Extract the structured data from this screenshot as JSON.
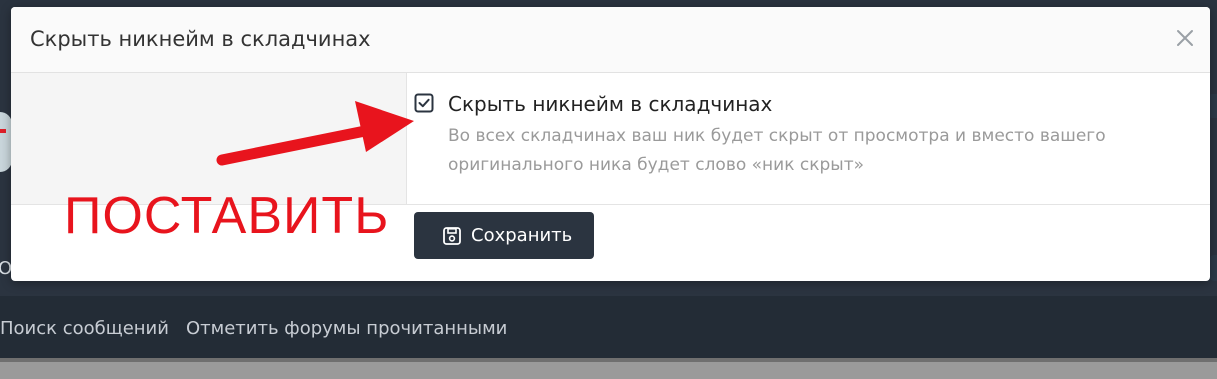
{
  "modal": {
    "title": "Скрыть никнейм в складчинах",
    "close_icon": "close-icon",
    "option": {
      "checked": true,
      "label": "Скрыть никнейм в складчинах",
      "hint_line1": "Во всех складчинах ваш ник будет скрыт от просмотра и вместо вашего",
      "hint_line2": "оригинального ника будет слово «ник скрыт»"
    },
    "save_button": {
      "label": "Сохранить",
      "icon": "save-icon"
    }
  },
  "background": {
    "nav_links": [
      "Поиск сообщений",
      "Отметить форумы прочитанными"
    ],
    "left_text": "ОХ"
  },
  "annotation": {
    "text": "ПОСТАВИТЬ",
    "color": "#e8141d"
  },
  "colors": {
    "button_bg": "#2b3440",
    "accent_checkbox": "#2b3440",
    "hint_text": "#9a9a9a"
  }
}
